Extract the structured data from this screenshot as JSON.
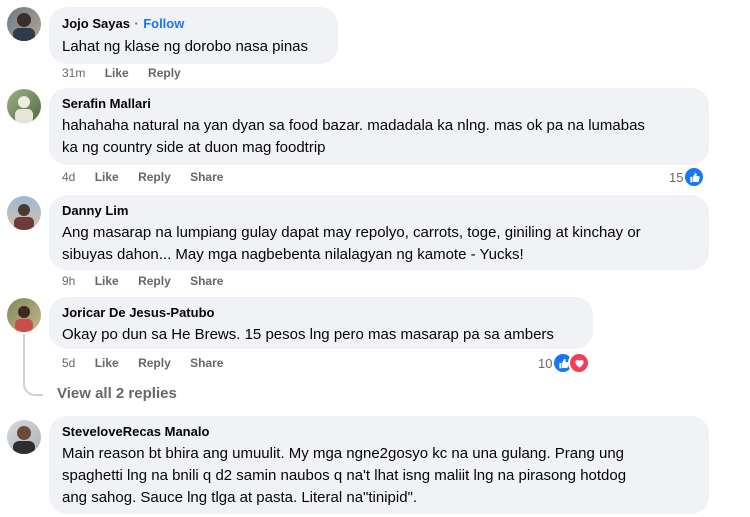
{
  "comments": [
    {
      "author": "Jojo Sayas",
      "separator": "·",
      "follow": "Follow",
      "text": "Lahat ng klase ng dorobo nasa pinas",
      "time": "31m",
      "like": "Like",
      "reply": "Reply"
    },
    {
      "author": "Serafin Mallari",
      "text_lines": [
        "hahahaha natural na yan dyan sa food bazar. madadala ka nlng. mas ok pa na lumabas",
        "ka ng country side at duon mag foodtrip"
      ],
      "time": "4d",
      "like": "Like",
      "reply": "Reply",
      "share": "Share",
      "reaction_count": "15"
    },
    {
      "author": "Danny Lim",
      "text_lines": [
        "Ang masarap na lumpiang gulay dapat may repolyo, carrots, toge, giniling at kinchay or",
        "sibuyas dahon... May mga nagbebenta nilalagyan ng kamote - Yucks!"
      ],
      "time": "9h",
      "like": "Like",
      "reply": "Reply",
      "share": "Share"
    },
    {
      "author": "Joricar De Jesus-Patubo",
      "text": "Okay po dun sa He Brews. 15 pesos lng pero mas masarap pa sa ambers",
      "time": "5d",
      "like": "Like",
      "reply": "Reply",
      "share": "Share",
      "reaction_count": "10"
    },
    {
      "author": "SteveloveRecas Manalo",
      "text_lines": [
        "Main reason bt bhira ang umuulit. My mga ngne2gosyo kc na una gulang. Prang ung",
        "spaghetti lng na bnili q d2 samin naubos q na't lhat isng maliit lng na pirasong hotdog",
        "ang sahog. Sauce lng tlga at pasta. Literal na\"tinipid\"."
      ]
    }
  ],
  "view_replies": "View all 2 replies",
  "colors": {
    "bubble": "#f0f2f5",
    "link": "#1877f2",
    "muted": "#65676b",
    "love": "#f33e58"
  }
}
